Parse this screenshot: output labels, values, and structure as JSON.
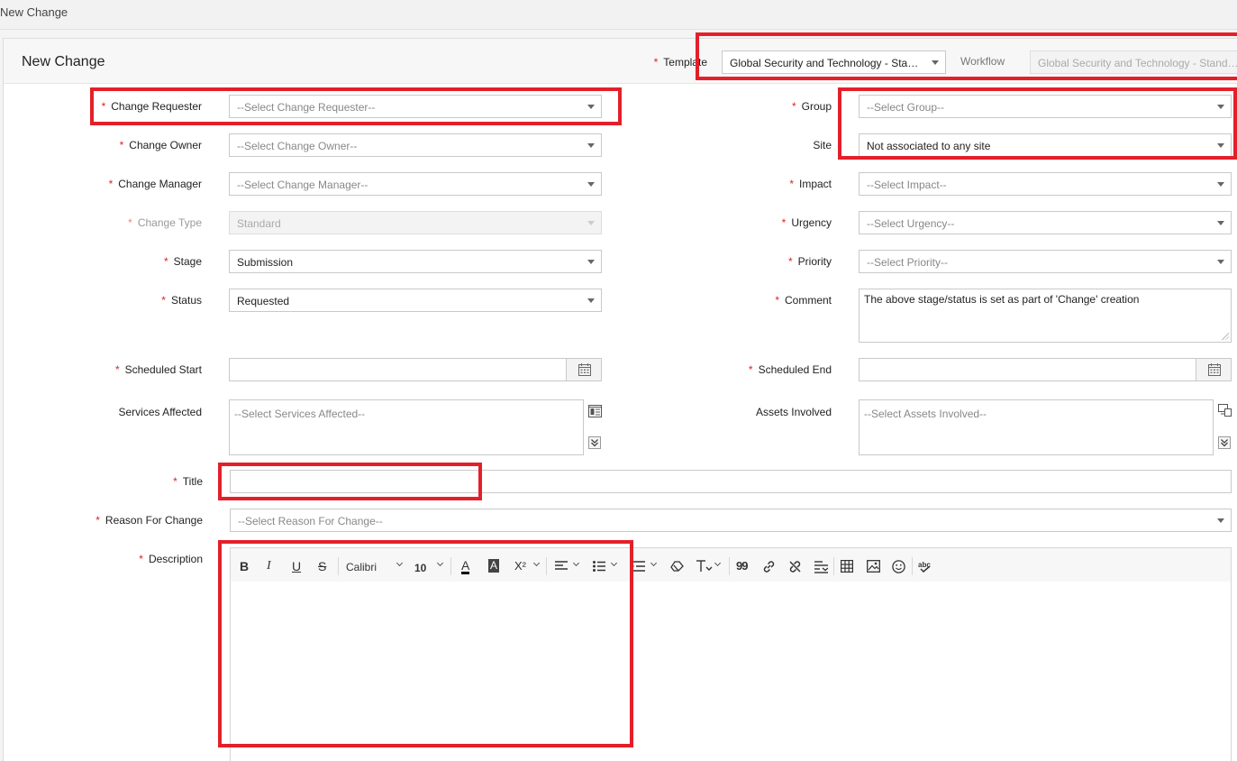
{
  "window": {
    "title": "New Change"
  },
  "panel": {
    "title": "New Change"
  },
  "template": {
    "label": "Template",
    "value": "Global Security and Technology - Stand...",
    "workflow_label": "Workflow",
    "workflow_value": "Global Security and Technology - Standard"
  },
  "fields": {
    "change_requester": {
      "label": "Change Requester",
      "placeholder": "--Select Change Requester--"
    },
    "change_owner": {
      "label": "Change Owner",
      "placeholder": "--Select Change Owner--"
    },
    "change_manager": {
      "label": "Change Manager",
      "placeholder": "--Select Change Manager--"
    },
    "change_type": {
      "label": "Change Type",
      "value": "Standard"
    },
    "stage": {
      "label": "Stage",
      "value": "Submission"
    },
    "status": {
      "label": "Status",
      "value": "Requested"
    },
    "scheduled_start": {
      "label": "Scheduled Start"
    },
    "services_affected": {
      "label": "Services Affected",
      "placeholder": "--Select Services Affected--"
    },
    "group": {
      "label": "Group",
      "placeholder": "--Select Group--"
    },
    "site": {
      "label": "Site",
      "value": "Not associated to any site"
    },
    "impact": {
      "label": "Impact",
      "placeholder": "--Select Impact--"
    },
    "urgency": {
      "label": "Urgency",
      "placeholder": "--Select Urgency--"
    },
    "priority": {
      "label": "Priority",
      "placeholder": "--Select Priority--"
    },
    "comment": {
      "label": "Comment",
      "value": "The above stage/status is set as part of 'Change' creation"
    },
    "scheduled_end": {
      "label": "Scheduled End"
    },
    "assets_involved": {
      "label": "Assets Involved",
      "placeholder": "--Select Assets Involved--"
    },
    "title": {
      "label": "Title"
    },
    "reason_for_change": {
      "label": "Reason For Change",
      "placeholder": "--Select Reason For Change--"
    },
    "description": {
      "label": "Description"
    }
  },
  "required_mark": "*",
  "editor_toolbar": {
    "bold": "B",
    "italic": "I",
    "underline": "U",
    "strike": "S",
    "font": "Calibri",
    "size": "10",
    "font_color": "A",
    "highlight": "A",
    "superscript": "X²",
    "quote": "99",
    "spellcheck": "abc"
  },
  "colors": {
    "accent_red": "#e3202a",
    "required": "#e02020"
  }
}
